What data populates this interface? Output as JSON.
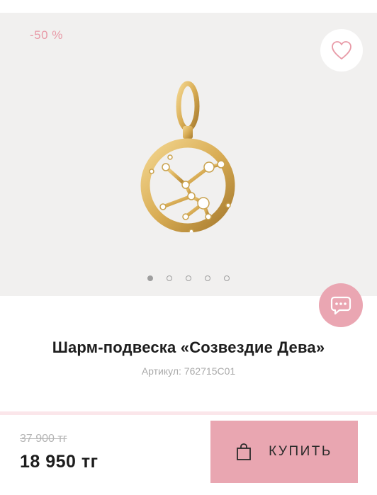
{
  "gallery": {
    "badge": "-50 %",
    "image_alt": "Шарм-подвеска «Созвездие Дева»",
    "slides_total": 5,
    "active_slide": 1
  },
  "product": {
    "title": "Шарм-подвеска «Созвездие Дева»",
    "sku": "Артикул: 762715C01"
  },
  "pricing": {
    "old_price": "37 900 тг",
    "price": "18 950 тг"
  },
  "actions": {
    "buy_label": "КУПИТЬ",
    "favorite_icon": "heart-icon",
    "chat_icon": "chat-bubble-icon",
    "cart_icon": "shopping-bag-icon"
  },
  "colors": {
    "accent_pink": "#e9a6b1",
    "badge_pink": "#e89aa7",
    "gallery_bg": "#f1f0ef",
    "gold": "#d9ad55"
  }
}
